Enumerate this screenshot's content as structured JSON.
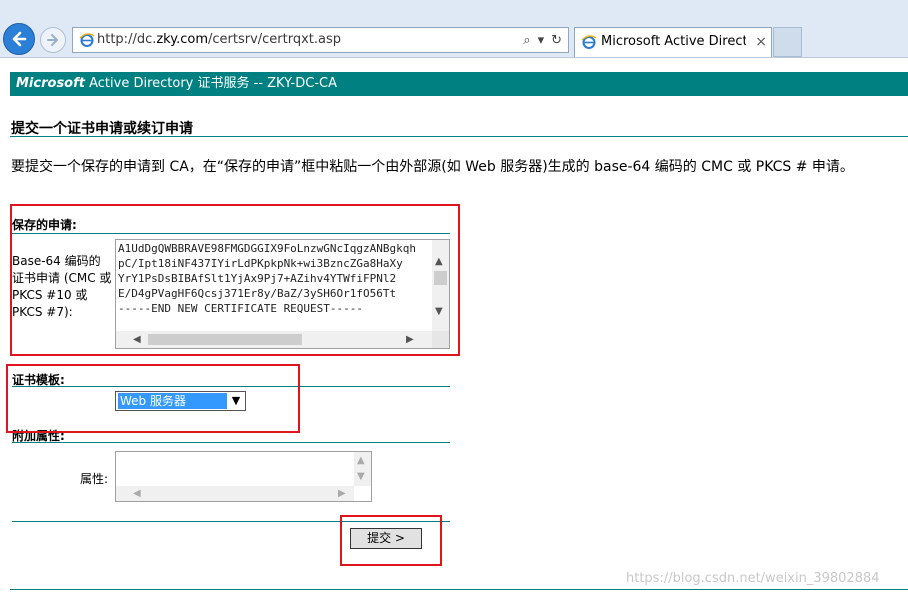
{
  "browser": {
    "url_prefix": "http://dc.",
    "url_domain": "zky.com",
    "url_path": "/certsrv/certrqxt.asp",
    "search_glyph": "⌕",
    "dropdown_glyph": "▾",
    "refresh_glyph": "↻",
    "tab_title": "Microsoft Active Director...",
    "tab_close": "×"
  },
  "banner": {
    "brand": "Microsoft",
    "title": " Active Directory 证书服务  --  ZKY-DC-CA"
  },
  "page": {
    "title": "提交一个证书申请或续订申请",
    "intro": "要提交一个保存的申请到 CA，在“保存的申请”框中粘贴一个由外部源(如 Web 服务器)生成的 base-64 编码的 CMC 或 PKCS # 申请。"
  },
  "saved_request": {
    "section_label": "保存的申请:",
    "field_label": "Base-64 编码的证书申请 (CMC 或 PKCS #10 或 PKCS #7):",
    "text": "A1UdDgQWBBRAVE98FMGDGGIX9FoLnzwGNcIqgzANBgkqh\npC/Ipt18iNF437IYirLdPKpkpNk+wi3BzncZGa8HaXy\nYrY1PsDsBIBAfSlt1YjAx9Pj7+AZihv4YTWfiFPNl2\nE/D4gPVagHF6Qcsj371Er8y/BaZ/3ySH6Or1fO56Tt\n-----END NEW CERTIFICATE REQUEST-----"
  },
  "template": {
    "section_label": "证书模板:",
    "selected": "Web 服务器",
    "arrow_glyph": "▼"
  },
  "attributes": {
    "section_label": "附加属性:",
    "field_label": "属性:",
    "value": ""
  },
  "submit": {
    "label": "提交 >"
  },
  "watermark": "https://blog.csdn.net/weixin_39802884",
  "colors": {
    "accent": "#008080",
    "highlight": "#e0141d",
    "chrome": "#dfe9f5"
  }
}
